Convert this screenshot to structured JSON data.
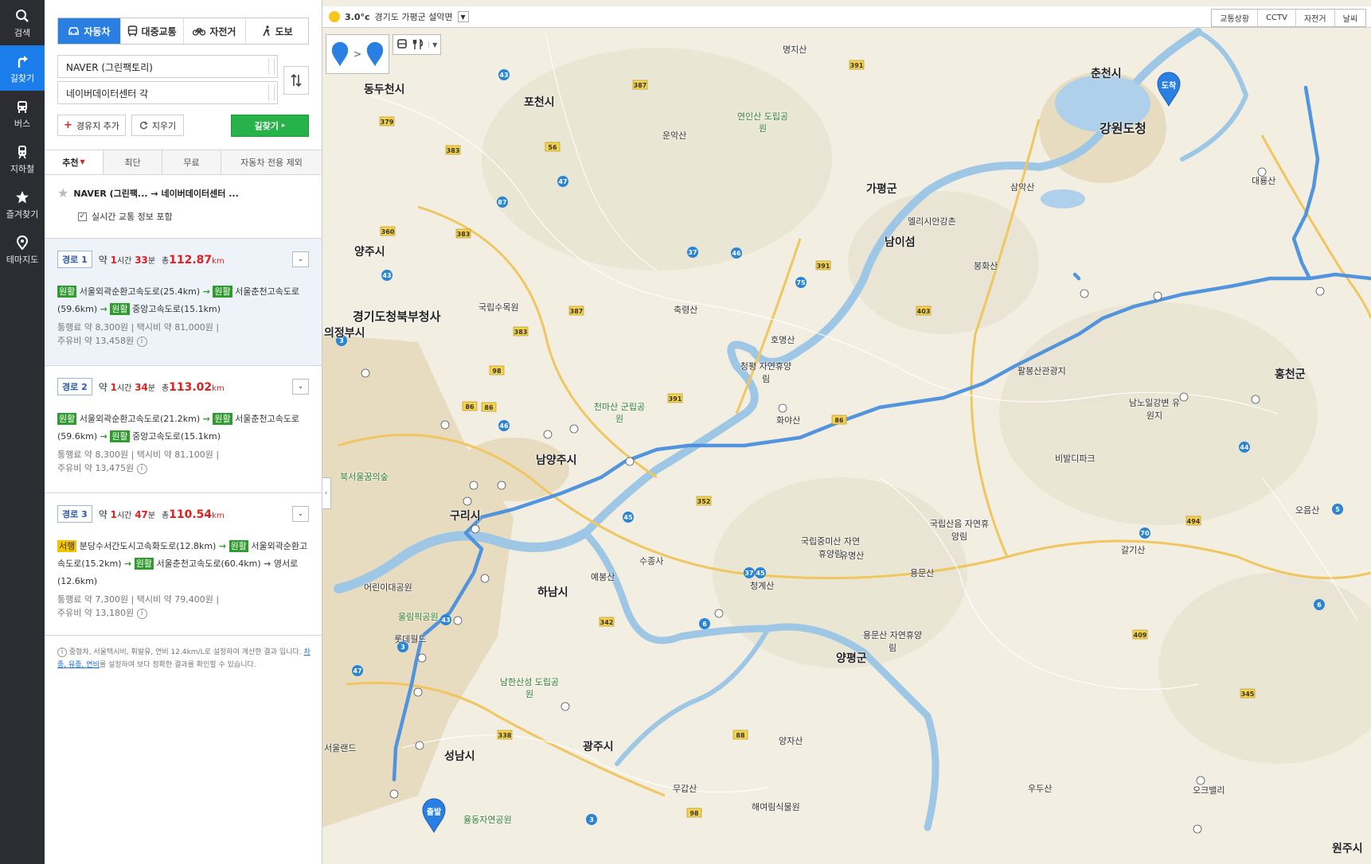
{
  "rail": [
    {
      "label": "검색",
      "icon": "search-icon"
    },
    {
      "label": "길찾기",
      "icon": "directions-icon",
      "active": true
    },
    {
      "label": "버스",
      "icon": "bus-icon"
    },
    {
      "label": "지하철",
      "icon": "subway-icon"
    },
    {
      "label": "즐겨찾기",
      "icon": "star-icon"
    },
    {
      "label": "테마지도",
      "icon": "pin-icon"
    }
  ],
  "modes": [
    {
      "label": "자동차",
      "icon": "car-icon",
      "active": true
    },
    {
      "label": "대중교통",
      "icon": "bus-icon"
    },
    {
      "label": "자전거",
      "icon": "bicycle-icon"
    },
    {
      "label": "도보",
      "icon": "walk-icon"
    }
  ],
  "origin": "NAVER (그린팩토리)",
  "destination": "네이버데이터센터 각",
  "buttons": {
    "add_waypoint": "경유지 추가",
    "clear": "지우기",
    "search": "길찾기"
  },
  "option_tabs": [
    "추천",
    "최단",
    "무료",
    "자동차 전용 제외"
  ],
  "summary": {
    "title": "NAVER (그린팩... → 네이버데이터센터 ...",
    "realtime": "실시간 교통 정보 포함"
  },
  "routes": [
    {
      "badge": "경로 1",
      "time_prefix": "약",
      "hours": "1",
      "hours_unit": "시간",
      "minutes": "33",
      "minutes_unit": "분",
      "dist_prefix": "총",
      "distance": "112.87",
      "dist_unit": "km",
      "segments": [
        {
          "tag": "원활",
          "name": "서울외곽순환고속도로(25.4km)"
        },
        {
          "tag": "원활",
          "name": "서울춘천고속도로(59.6km)"
        },
        {
          "tag": "원활",
          "name": "중앙고속도로(15.1km)"
        }
      ],
      "toll": "통행료 약 8,300원",
      "taxi": "택시비 약 81,000원",
      "fuel": "주유비 약 13,458원"
    },
    {
      "badge": "경로 2",
      "time_prefix": "약",
      "hours": "1",
      "hours_unit": "시간",
      "minutes": "34",
      "minutes_unit": "분",
      "dist_prefix": "총",
      "distance": "113.02",
      "dist_unit": "km",
      "segments": [
        {
          "tag": "원활",
          "name": "서울외곽순환고속도로(21.2km)"
        },
        {
          "tag": "원활",
          "name": "서울춘천고속도로(59.6km)"
        },
        {
          "tag": "원활",
          "name": "중앙고속도로(15.1km)"
        }
      ],
      "toll": "통행료 약 8,300원",
      "taxi": "택시비 약 81,100원",
      "fuel": "주유비 약 13,475원"
    },
    {
      "badge": "경로 3",
      "time_prefix": "약",
      "hours": "1",
      "hours_unit": "시간",
      "minutes": "47",
      "minutes_unit": "분",
      "dist_prefix": "총",
      "distance": "110.54",
      "dist_unit": "km",
      "segments": [
        {
          "tag": "서행",
          "name": "분당수서간도시고속화도로(12.8km)"
        },
        {
          "tag": "원활",
          "name": "서울외곽순환고속도로(15.2km)"
        },
        {
          "tag": "원활",
          "name": "서울춘천고속도로(60.4km)"
        },
        {
          "tag": "",
          "name": "영서로(12.6km)"
        }
      ],
      "toll": "통행료 약 7,300원",
      "taxi": "택시비 약 79,400원",
      "fuel": "주유비 약 13,180원"
    }
  ],
  "note": {
    "text": "중형차, 서울택시비, 휘발유, 연비 12.4km/L로 설정하여 계산한 결과 입니다.",
    "link": "차종, 유종, 연비",
    "suffix": "를 설정하여 보다 정확한 결과를 확인할 수 있습니다."
  },
  "weather": {
    "temp": "3.0°c",
    "location": "경기도 가평군 설악면"
  },
  "layer_buttons": [
    "교통상황",
    "CCTV",
    "자전거",
    "날씨"
  ],
  "markers": {
    "start": "출발",
    "end": "도착"
  },
  "colors": {
    "accent": "#2a7fe2",
    "go": "#27b24a",
    "route": "#3f84d6",
    "traffic_good": "#2f9a2e",
    "traffic_slow": "#f4c300"
  },
  "map_labels": [
    {
      "t": "춘천시",
      "c": "city"
    },
    {
      "t": "강원도청",
      "c": "city"
    },
    {
      "t": "가평군",
      "c": "city"
    },
    {
      "t": "남이섬",
      "c": "city"
    },
    {
      "t": "양주시",
      "c": "city"
    },
    {
      "t": "포천시",
      "c": "city"
    },
    {
      "t": "동두천시",
      "c": "city"
    },
    {
      "t": "경기도청북부청사",
      "c": "city"
    },
    {
      "t": "의정부시",
      "c": "city"
    },
    {
      "t": "남양주시",
      "c": "city"
    },
    {
      "t": "구리시",
      "c": "city"
    },
    {
      "t": "하남시",
      "c": "city"
    },
    {
      "t": "성남시",
      "c": "city"
    },
    {
      "t": "광주시",
      "c": "city"
    },
    {
      "t": "양평군",
      "c": "city"
    },
    {
      "t": "홍천군",
      "c": "city"
    },
    {
      "t": "연인산 도립공원",
      "c": "park"
    },
    {
      "t": "천마산 군립공원",
      "c": "park"
    },
    {
      "t": "남한산성 도립공원",
      "c": "park"
    },
    {
      "t": "청평 자연휴양림",
      "c": "place"
    },
    {
      "t": "국립중미산 자연휴양림",
      "c": "place"
    },
    {
      "t": "국립산음 자연휴양림",
      "c": "place"
    },
    {
      "t": "용문산 자연휴양림",
      "c": "place"
    },
    {
      "t": "비발디파크",
      "c": "place"
    },
    {
      "t": "엘리시안강촌",
      "c": "place"
    },
    {
      "t": "팔봉산관광지",
      "c": "place"
    },
    {
      "t": "남노일강변 유원지",
      "c": "place"
    },
    {
      "t": "삼악산",
      "c": "place"
    },
    {
      "t": "화야산",
      "c": "place"
    },
    {
      "t": "유명산",
      "c": "place"
    },
    {
      "t": "용문산",
      "c": "place"
    },
    {
      "t": "갈기산",
      "c": "place"
    },
    {
      "t": "봉화산",
      "c": "place"
    },
    {
      "t": "대룡산",
      "c": "place"
    },
    {
      "t": "호명산",
      "c": "place"
    },
    {
      "t": "명지산",
      "c": "place"
    },
    {
      "t": "운악산",
      "c": "place"
    },
    {
      "t": "국립수목원",
      "c": "place"
    },
    {
      "t": "축령산",
      "c": "place"
    },
    {
      "t": "수종사",
      "c": "place"
    },
    {
      "t": "예봉산",
      "c": "place"
    },
    {
      "t": "청계산",
      "c": "place"
    },
    {
      "t": "양자산",
      "c": "place"
    },
    {
      "t": "무갑산",
      "c": "place"
    },
    {
      "t": "해여림식물원",
      "c": "place"
    },
    {
      "t": "우두산",
      "c": "place"
    },
    {
      "t": "오크밸리",
      "c": "place"
    },
    {
      "t": "울림픽공원",
      "c": "park"
    },
    {
      "t": "롯데월드",
      "c": "place"
    },
    {
      "t": "어린이대공원",
      "c": "place"
    },
    {
      "t": "서울랜드",
      "c": "place"
    },
    {
      "t": "율동자연공원",
      "c": "park"
    },
    {
      "t": "원주시",
      "c": "city"
    },
    {
      "t": "북서울꿈의숲",
      "c": "park"
    },
    {
      "t": "오음산",
      "c": "place"
    }
  ]
}
